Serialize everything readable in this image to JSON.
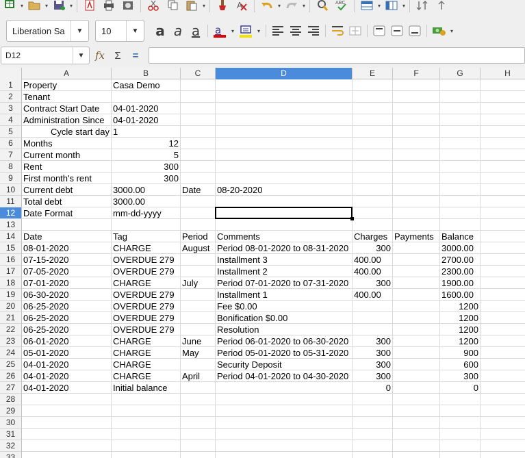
{
  "toolbar": {
    "font_name": "Liberation Sa",
    "font_size": "10",
    "bold_glyph": "a",
    "italic_glyph": "a",
    "underline_glyph": "a"
  },
  "formula_bar": {
    "cell_reference": "D12",
    "function_wizard": "fx",
    "sum_glyph": "Σ",
    "equals_glyph": "=",
    "formula_value": ""
  },
  "columns": [
    "A",
    "B",
    "C",
    "D",
    "E",
    "F",
    "G",
    "H"
  ],
  "selected": {
    "column": "D",
    "row": 12
  },
  "rows": [
    {
      "n": "1",
      "cells": [
        "Property",
        "Casa Demo",
        "",
        "",
        "",
        "",
        "",
        ""
      ]
    },
    {
      "n": "2",
      "cells": [
        "Tenant",
        "",
        "",
        "",
        "",
        "",
        "",
        ""
      ]
    },
    {
      "n": "3",
      "cells": [
        "Contract Start Date",
        "04-01-2020",
        "",
        "",
        "",
        "",
        "",
        ""
      ]
    },
    {
      "n": "4",
      "cells": [
        "Administration Since",
        "04-01-2020",
        "",
        "",
        "",
        "",
        "",
        ""
      ]
    },
    {
      "n": "5",
      "cells": [
        "Cycle start day",
        "1",
        "",
        "",
        "",
        "",
        "",
        ""
      ]
    },
    {
      "n": "6",
      "cells": [
        "Months",
        "12",
        "",
        "",
        "",
        "",
        "",
        ""
      ]
    },
    {
      "n": "7",
      "cells": [
        "Current month",
        "5",
        "",
        "",
        "",
        "",
        "",
        ""
      ]
    },
    {
      "n": "8",
      "cells": [
        "Rent",
        "300",
        "",
        "",
        "",
        "",
        "",
        ""
      ]
    },
    {
      "n": "9",
      "cells": [
        "First month's rent",
        "300",
        "",
        "",
        "",
        "",
        "",
        ""
      ]
    },
    {
      "n": "10",
      "cells": [
        "Current debt",
        "3000.00",
        "Date",
        "08-20-2020",
        "",
        "",
        "",
        ""
      ]
    },
    {
      "n": "11",
      "cells": [
        "Total debt",
        "3000.00",
        "",
        "",
        "",
        "",
        "",
        ""
      ]
    },
    {
      "n": "12",
      "cells": [
        "Date Format",
        "mm-dd-yyyy",
        "",
        "",
        "",
        "",
        "",
        ""
      ]
    },
    {
      "n": "13",
      "cells": [
        "",
        "",
        "",
        "",
        "",
        "",
        "",
        ""
      ]
    },
    {
      "n": "14",
      "cells": [
        "Date",
        "Tag",
        "Period",
        "Comments",
        "Charges",
        "Payments",
        "Balance",
        ""
      ]
    },
    {
      "n": "15",
      "cells": [
        "08-01-2020",
        "CHARGE",
        "August",
        "Period 08-01-2020 to 08-31-2020",
        "300",
        "",
        "3000.00",
        ""
      ]
    },
    {
      "n": "16",
      "cells": [
        "07-15-2020",
        "OVERDUE 279",
        "",
        "Installment 3",
        "400.00",
        "",
        "2700.00",
        ""
      ]
    },
    {
      "n": "17",
      "cells": [
        "07-05-2020",
        "OVERDUE 279",
        "",
        "Installment 2",
        "400.00",
        "",
        "2300.00",
        ""
      ]
    },
    {
      "n": "18",
      "cells": [
        "07-01-2020",
        "CHARGE",
        "July",
        "Period 07-01-2020 to 07-31-2020",
        "300",
        "",
        "1900.00",
        ""
      ]
    },
    {
      "n": "19",
      "cells": [
        "06-30-2020",
        "OVERDUE 279",
        "",
        "Installment 1",
        "400.00",
        "",
        "1600.00",
        ""
      ]
    },
    {
      "n": "20",
      "cells": [
        "06-25-2020",
        "OVERDUE 279",
        "",
        "Fee $0.00",
        "",
        "",
        "1200",
        ""
      ]
    },
    {
      "n": "21",
      "cells": [
        "06-25-2020",
        "OVERDUE 279",
        "",
        "Bonification $0.00",
        "",
        "",
        "1200",
        ""
      ]
    },
    {
      "n": "22",
      "cells": [
        "06-25-2020",
        "OVERDUE 279",
        "",
        "Resolution",
        "",
        "",
        "1200",
        ""
      ]
    },
    {
      "n": "23",
      "cells": [
        "06-01-2020",
        "CHARGE",
        "June",
        "Period 06-01-2020 to 06-30-2020",
        "300",
        "",
        "1200",
        ""
      ]
    },
    {
      "n": "24",
      "cells": [
        "05-01-2020",
        "CHARGE",
        "May",
        "Period 05-01-2020 to 05-31-2020",
        "300",
        "",
        "900",
        ""
      ]
    },
    {
      "n": "25",
      "cells": [
        "04-01-2020",
        "CHARGE",
        "",
        "Security Deposit",
        "300",
        "",
        "600",
        ""
      ]
    },
    {
      "n": "26",
      "cells": [
        "04-01-2020",
        "CHARGE",
        "April",
        "Period 04-01-2020 to 04-30-2020",
        "300",
        "",
        "300",
        ""
      ]
    },
    {
      "n": "27",
      "cells": [
        "04-01-2020",
        "Initial balance",
        "",
        "",
        "0",
        "",
        "0",
        ""
      ]
    },
    {
      "n": "28",
      "cells": [
        "",
        "",
        "",
        "",
        "",
        "",
        "",
        ""
      ]
    },
    {
      "n": "29",
      "cells": [
        "",
        "",
        "",
        "",
        "",
        "",
        "",
        ""
      ]
    },
    {
      "n": "30",
      "cells": [
        "",
        "",
        "",
        "",
        "",
        "",
        "",
        ""
      ]
    },
    {
      "n": "31",
      "cells": [
        "",
        "",
        "",
        "",
        "",
        "",
        "",
        ""
      ]
    },
    {
      "n": "32",
      "cells": [
        "",
        "",
        "",
        "",
        "",
        "",
        "",
        ""
      ]
    },
    {
      "n": "33",
      "cells": [
        "",
        "",
        "",
        "",
        "",
        "",
        "",
        ""
      ]
    }
  ],
  "right_aligned": [
    "4-0",
    "5-1",
    "6-1",
    "7-1",
    "8-1",
    "14-4",
    "17-4",
    "19-4",
    "22-4",
    "23-4",
    "24-4",
    "25-4",
    "26-4",
    "19-6",
    "20-6",
    "21-6",
    "22-6",
    "23-6",
    "24-6",
    "25-6",
    "26-6"
  ],
  "colors": {
    "selection_header": "#4a8cdb",
    "header_bg": "#f2f2f2",
    "grid_line": "#dadada",
    "font_color_bar": "#e00000",
    "highlight_bar": "#f5e000"
  }
}
